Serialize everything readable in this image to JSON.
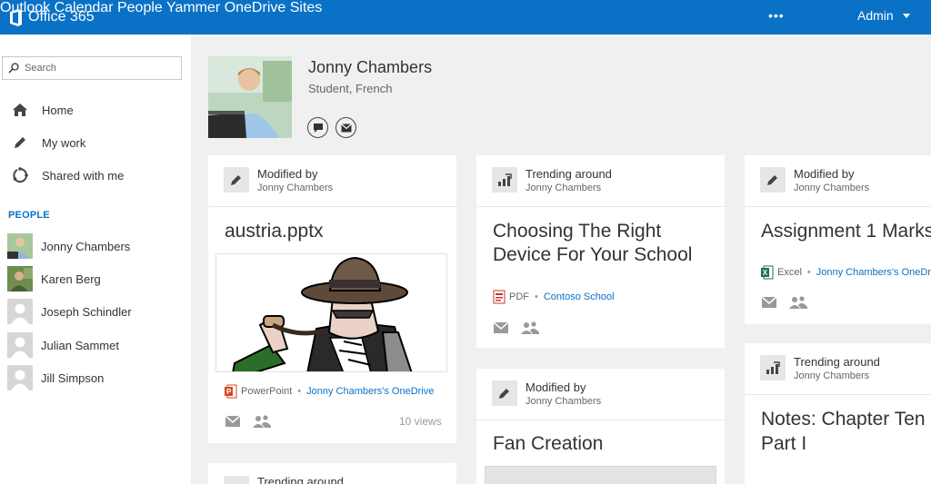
{
  "app": {
    "brand": "Office 365"
  },
  "topnav": {
    "items": [
      "Outlook",
      "Calendar",
      "People",
      "Yammer",
      "OneDrive",
      "Sites"
    ],
    "more": "•••",
    "user": "Admin"
  },
  "sidebar": {
    "search_placeholder": "Search",
    "nav": [
      "Home",
      "My work",
      "Shared with me"
    ],
    "people_label": "PEOPLE",
    "people": [
      "Jonny Chambers",
      "Karen Berg",
      "Joseph Schindler",
      "Julian Sammet",
      "Jill Simpson"
    ]
  },
  "profile": {
    "name": "Jonny Chambers",
    "role": "Student, French"
  },
  "cards": [
    {
      "activity": "Modified by",
      "person": "Jonny Chambers",
      "title": "austria.pptx",
      "file_type": "PowerPoint",
      "source": "Jonny Chambers's OneDrive",
      "views": "10 views"
    },
    {
      "activity": "Trending around",
      "person": "Jonny Chambers",
      "title_line1": "Choosing The Right",
      "title_line2": "Device For Your School",
      "file_type": "PDF",
      "source": "Contoso School"
    },
    {
      "activity": "Modified by",
      "person": "Jonny Chambers",
      "title": "Assignment 1 Marks",
      "file_type": "Excel",
      "source": "Jonny Chambers's OneDrive"
    },
    {
      "activity": "Modified by",
      "person": "Jonny Chambers",
      "title": "Fan Creation"
    },
    {
      "activity": "Trending around",
      "person": "Jonny Chambers",
      "title_line1": "Notes: Chapter Ten",
      "title_line2": "Part I"
    },
    {
      "activity": "Trending around"
    }
  ],
  "colors": {
    "brand_blue": "#0a72c6",
    "link": "#0a72c6",
    "powerpoint": "#d24726",
    "excel": "#207245",
    "pdf": "#c8392b"
  }
}
